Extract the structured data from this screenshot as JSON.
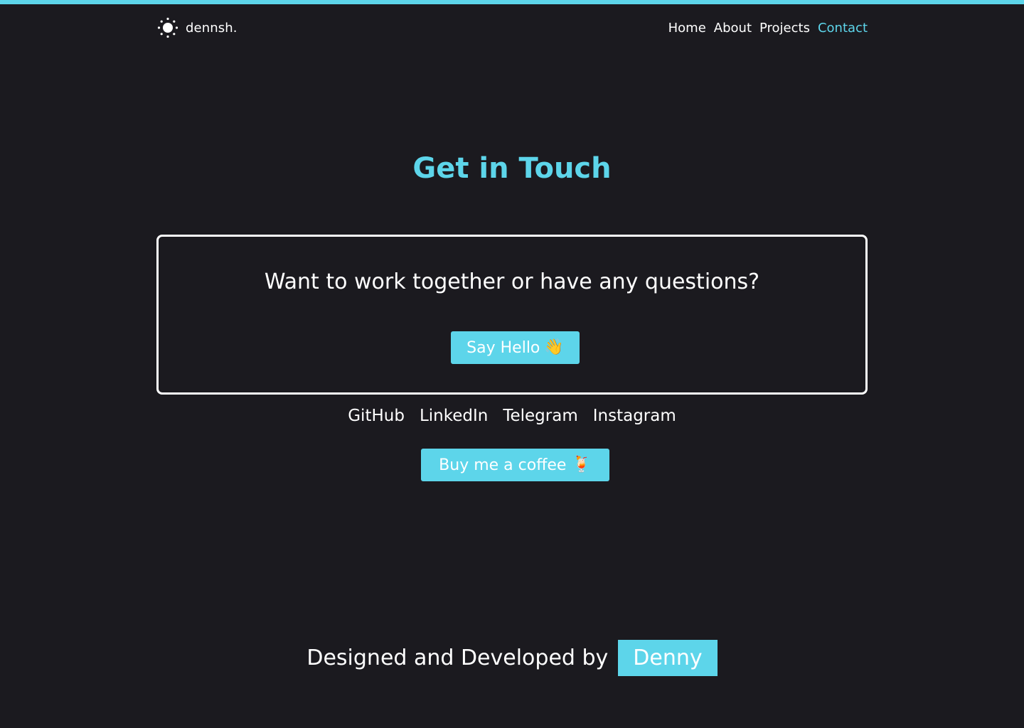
{
  "colors": {
    "background": "#1b1a1f",
    "accent": "#5dd5ea",
    "text": "#ffffff"
  },
  "header": {
    "brand": "dennsh.",
    "brand_icon": "sun-icon",
    "nav": [
      {
        "label": "Home",
        "active": false
      },
      {
        "label": "About",
        "active": false
      },
      {
        "label": "Projects",
        "active": false
      },
      {
        "label": "Contact",
        "active": true
      }
    ]
  },
  "main": {
    "title": "Get in Touch",
    "card": {
      "question": "Want to work together or have any questions?",
      "say_hello_label": "Say Hello",
      "say_hello_emoji": "👋"
    },
    "socials": [
      "GitHub",
      "LinkedIn",
      "Telegram",
      "Instagram"
    ],
    "coffee_label": "Buy me a coffee",
    "coffee_emoji": "🍹"
  },
  "footer": {
    "text": "Designed and Developed by",
    "name": "Denny"
  }
}
